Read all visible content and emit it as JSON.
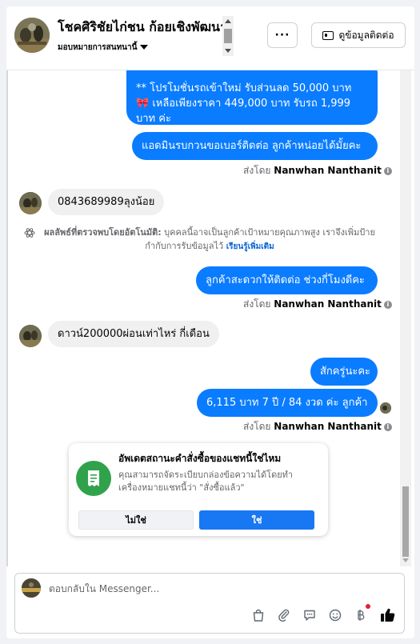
{
  "header": {
    "page_name": "โชคศิริชัยไก่ชน ก้อยเชิงพัฒนา",
    "assign_label": "มอบหมายการสนทนานี้",
    "more_label": "···",
    "contact_info_label": "ดูข้อมูลติดต่อ"
  },
  "messages": {
    "promo_line1": "** โปรโมชั่นรถเข้าใหม่ รับส่วนลด 50,000 บาท",
    "promo_line2": "🎀 เหลือเพียงราคา 449,000 บาท รับรถ 1,999",
    "promo_line3": "บาท ค่ะ",
    "admin_ask_number": "แอดมินรบกวนขอเบอร์ติดต่อ ลูกค้าหน่อยได้มั้ยคะ",
    "customer_phone": "0843689989ลุงน้อย",
    "agent_ask_time": "ลูกค้าสะดวกให้ติดต่อ ช่วงกี่โมงดีคะ",
    "customer_down_payment": "ดาวน์200000ผ่อนเท่าไหร่ กี่เดือน",
    "agent_wait": "สักครู่นะคะ",
    "agent_quote": "6,115 บาท  7 ปี / 84 งวด ค่ะ ลูกค้า",
    "sent_by_prefix": "ส่งโดย",
    "sent_by_name": "Nanwhan Nanthanit"
  },
  "auto_detect": {
    "label": "ผลลัพธ์ที่ตรวจพบโดยอัตโนมัติ:",
    "text": "บุคคลนี้อาจเป็นลูกค้าเป้าหมายคุณภาพสูง เราจึงเพิ่มป้ายกำกับการรับข้อมูลไว้",
    "learn_more": "เรียนรู้เพิ่มเติม"
  },
  "status_card": {
    "title": "อัพเดตสถานะคำสั่งซื้อของแชทนี้ใช่ไหม",
    "description": "คุณสามารถจัดระเบียบกล่องข้อความได้โดยทำเครื่องหมายแชทนี้ว่า \"สั่งซื้อแล้ว\"",
    "no_label": "ไม่ใช่",
    "yes_label": "ใช่"
  },
  "composer": {
    "placeholder": "ตอบกลับใน Messenger..."
  },
  "colors": {
    "outgoing_bubble": "#0a7cff",
    "incoming_bubble": "#f0f0f0",
    "primary_button": "#1877f2",
    "status_icon": "#31a24c",
    "learn_more_link": "#0a64d6"
  },
  "icons": [
    "more-dots-icon",
    "contact-card-icon",
    "info-icon",
    "atom-icon",
    "order-receipt-icon",
    "shopping-bag-icon",
    "paperclip-icon",
    "saved-reply-icon",
    "emoji-icon",
    "baht-payment-icon",
    "thumbs-up-icon"
  ]
}
